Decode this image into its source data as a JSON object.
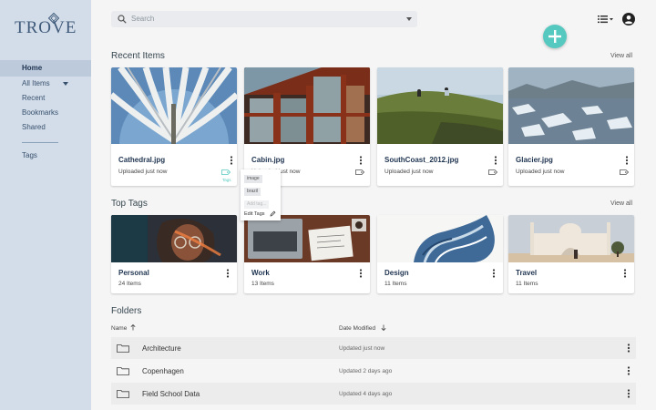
{
  "brand": {
    "logo_text": "TROVE"
  },
  "sidebar": {
    "items": [
      {
        "label": "Home",
        "active": true
      },
      {
        "label": "All Items",
        "has_caret": true
      },
      {
        "label": "Recent"
      },
      {
        "label": "Bookmarks"
      },
      {
        "label": "Shared"
      }
    ],
    "tags_label": "Tags"
  },
  "search": {
    "placeholder": "Search"
  },
  "icons": {
    "search": "search-icon",
    "list_view": "list-view-icon",
    "account": "account-circle-icon",
    "add": "plus-icon",
    "more": "more-vertical-icon",
    "tag": "tag-icon",
    "folder": "folder-icon",
    "pencil": "pencil-icon",
    "sort_up": "arrow-up-icon",
    "sort_down": "arrow-down-icon"
  },
  "colors": {
    "accent": "#55c9c0",
    "sidebar_bg": "#d3dde9",
    "sidebar_active": "#bccadb",
    "title_text": "#1f3450"
  },
  "recent": {
    "title": "Recent Items",
    "view_all": "View all",
    "items": [
      {
        "name": "Cathedral.jpg",
        "status": "Uploaded just now",
        "tags_caption": "Tags"
      },
      {
        "name": "Cabin.jpg",
        "status": "Uploaded just now"
      },
      {
        "name": "SouthCoast_2012.jpg",
        "status": "Uploaded just now"
      },
      {
        "name": "Glacier.jpg",
        "status": "Uploaded just now"
      }
    ]
  },
  "tag_popover": {
    "chips": [
      "image",
      "brazil"
    ],
    "add_placeholder": "Add tag...",
    "edit_label": "Edit Tags"
  },
  "top_tags": {
    "title": "Top Tags",
    "view_all": "View all",
    "items": [
      {
        "name": "Personal",
        "count": "24 Items"
      },
      {
        "name": "Work",
        "count": "13 Items"
      },
      {
        "name": "Design",
        "count": "11 Items"
      },
      {
        "name": "Travel",
        "count": "11 Items"
      }
    ]
  },
  "folders": {
    "title": "Folders",
    "col_name": "Name",
    "col_date": "Date Modified",
    "rows": [
      {
        "name": "Architecture",
        "modified": "Updated just now"
      },
      {
        "name": "Copenhagen",
        "modified": "Updated 2 days ago"
      },
      {
        "name": "Field School Data",
        "modified": "Updated 4 days ago"
      }
    ]
  }
}
